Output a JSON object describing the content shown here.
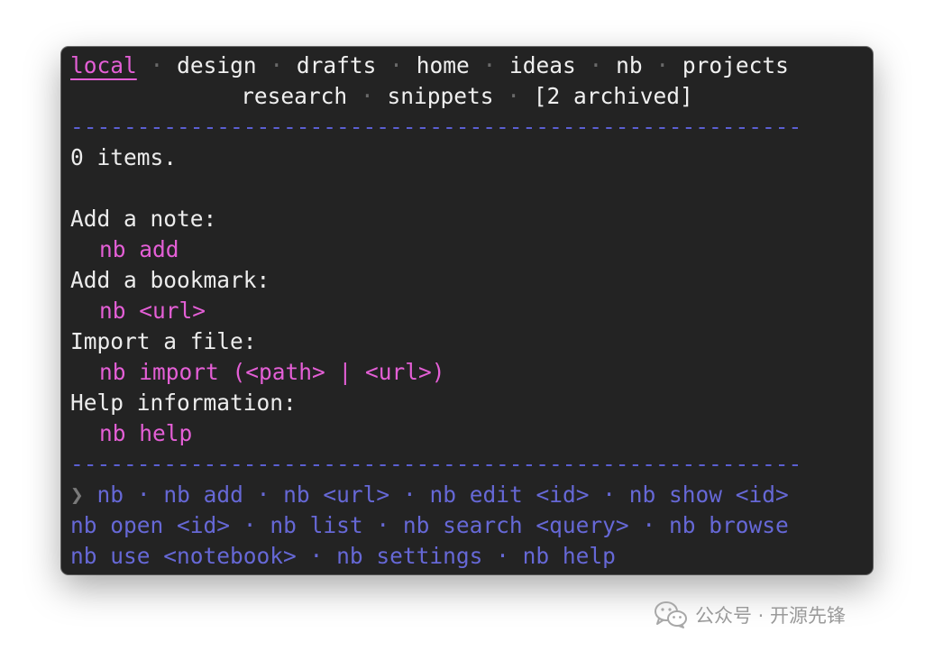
{
  "tabs": {
    "local": "local",
    "design": "design",
    "drafts": "drafts",
    "home": "home",
    "ideas": "ideas",
    "nb": "nb",
    "projects": "projects",
    "research": "research",
    "snippets": "snippets",
    "archived": "[2 archived]"
  },
  "separator_char": "·",
  "rule": "-------------------------------------------------------",
  "body": {
    "count": "0 items.",
    "add_note_label": "Add a note:",
    "add_note_cmd": "nb add",
    "add_bookmark_label": "Add a bookmark:",
    "add_bookmark_cmd": "nb <url>",
    "import_label": "Import a file:",
    "import_cmd": "nb import (<path> | <url>)",
    "help_label": "Help information:",
    "help_cmd": "nb help"
  },
  "footer": {
    "prompt": "❯",
    "cmds": [
      "nb",
      "nb add",
      "nb <url>",
      "nb edit <id>",
      "nb show <id>",
      "nb open <id>",
      "nb list",
      "nb search <query>",
      "nb browse",
      "nb use <notebook>",
      "nb settings",
      "nb help"
    ]
  },
  "watermark": {
    "text": "公众号 · 开源先锋",
    "icon": "wechat-icon"
  },
  "colors": {
    "background": "#232323",
    "accent_pink": "#e45fd6",
    "accent_blue": "#6668d6",
    "text": "#ececec"
  }
}
